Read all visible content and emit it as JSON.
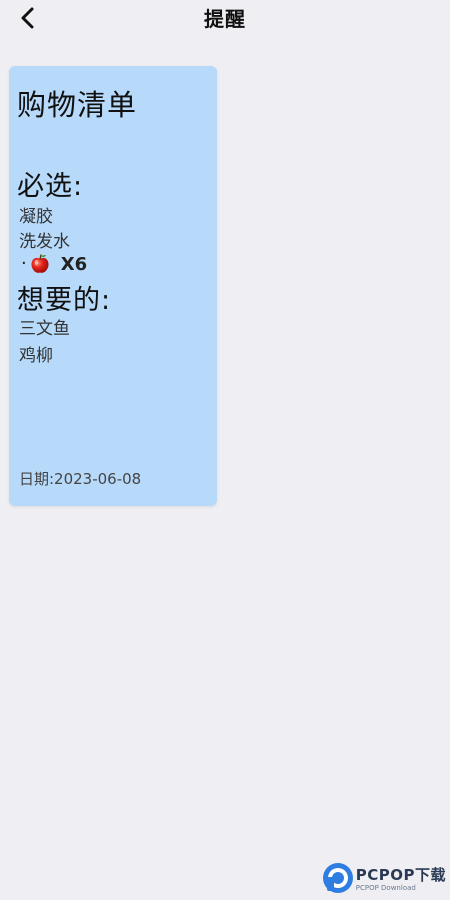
{
  "header": {
    "title": "提醒",
    "back_icon": "chevron-left-icon"
  },
  "note": {
    "title": "购物清单",
    "background_color": "#b7dafb",
    "required_heading": "必选:",
    "required_items": [
      "凝胶",
      "洗发水"
    ],
    "apple_item": {
      "icon": "apple-icon",
      "quantity": "X6"
    },
    "wanted_heading": "想要的:",
    "wanted_items": [
      "三文鱼",
      "鸡柳"
    ],
    "date": "日期:2023-06-08"
  },
  "watermark": {
    "logo": "pcpop-logo",
    "main_text": "PCPOP下载",
    "sub_text": "PCPOP Download"
  }
}
